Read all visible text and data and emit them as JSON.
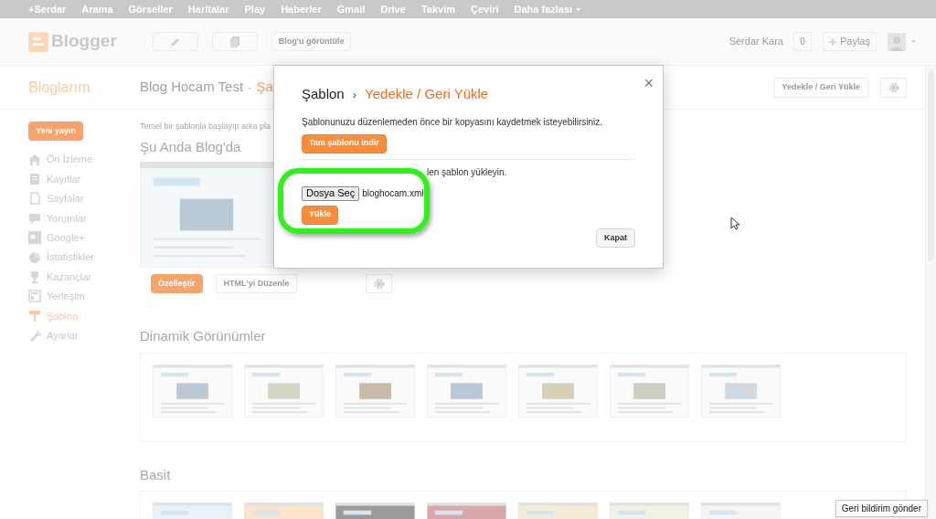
{
  "google_bar": {
    "items": [
      "+Serdar",
      "Arama",
      "Görseller",
      "Haritalar",
      "Play",
      "Haberler",
      "Gmail",
      "Drive",
      "Takvim",
      "Çeviri",
      "Daha fazlası"
    ]
  },
  "header": {
    "logo": "Blogger",
    "view_blog_button": "Blog'u görüntüle",
    "user_name": "Serdar Kara",
    "notification_count": "0",
    "share_button": "Paylaş"
  },
  "title_row": {
    "section": "Bloglarım",
    "blog_title": "Blog Hocam Test",
    "separator": "·",
    "page_title": "Şa",
    "backup_button": "Yedekle / Geri Yükle"
  },
  "sidebar": {
    "new_post_button": "Yeni yayın",
    "items": [
      {
        "label": "Ön İzleme",
        "kind": "home",
        "selected": false
      },
      {
        "label": "Kayıtlar",
        "kind": "posts",
        "selected": false
      },
      {
        "label": "Sayfalar",
        "kind": "pages",
        "selected": false
      },
      {
        "label": "Yorumlar",
        "kind": "comments",
        "selected": false
      },
      {
        "label": "Google+",
        "kind": "gplus",
        "selected": false
      },
      {
        "label": "İstatistikler",
        "kind": "stats",
        "selected": false
      },
      {
        "label": "Kazançlar",
        "kind": "earnings",
        "selected": false
      },
      {
        "label": "Yerleşim",
        "kind": "layout",
        "selected": false
      },
      {
        "label": "Şablon",
        "kind": "template",
        "selected": true
      },
      {
        "label": "Ayarlar",
        "kind": "settings",
        "selected": false
      }
    ]
  },
  "main": {
    "intro": "Temel bir şablonla başlayıp arka pla",
    "current_heading": "Şu Anda Blog'da",
    "customize_button": "Özelleştir",
    "edit_html_button": "HTML'yi Düzenle",
    "sections": [
      {
        "heading": "Dinamik Görünümler"
      },
      {
        "heading": "Basit"
      }
    ]
  },
  "dialog": {
    "breadcrumb": "Şablon",
    "separator": "›",
    "title": "Yedekle / Geri Yükle",
    "close": "×",
    "backup_text": "Şablonunuzu düzenlemeden önce bir kopyasını kaydetmek isteyebilirsiniz.",
    "download_button": "Tam şablonu indir",
    "upload_text": "len şablon yükleyin.",
    "file_button": "Dosya Seç",
    "file_name": "bloghocam.xml",
    "upload_button": "Yükle",
    "close_button": "Kapat"
  },
  "feedback_button": "Geri bildirim gönder"
}
